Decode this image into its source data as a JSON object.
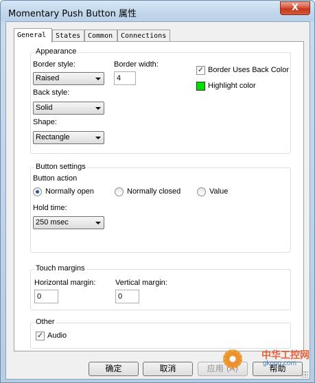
{
  "window": {
    "title": "Momentary Push Button 属性",
    "close_glyph": "X"
  },
  "tabs": [
    {
      "label": "General",
      "active": true
    },
    {
      "label": "States",
      "active": false
    },
    {
      "label": "Common",
      "active": false
    },
    {
      "label": "Connections",
      "active": false
    }
  ],
  "appearance": {
    "title": "Appearance",
    "border_style_label": "Border style:",
    "border_style_value": "Raised",
    "border_width_label": "Border width:",
    "border_width_value": "4",
    "back_style_label": "Back style:",
    "back_style_value": "Solid",
    "shape_label": "Shape:",
    "shape_value": "Rectangle",
    "border_uses_back_color_label": "Border Uses Back Color",
    "border_uses_back_color_checked": true,
    "highlight_color_label": "Highlight color",
    "highlight_color": "#00e000"
  },
  "button_settings": {
    "title": "Button settings",
    "action_label": "Button action",
    "options": [
      {
        "label": "Normally open",
        "selected": true
      },
      {
        "label": "Normally closed",
        "selected": false
      },
      {
        "label": "Value",
        "selected": false
      }
    ],
    "hold_time_label": "Hold time:",
    "hold_time_value": "250 msec"
  },
  "touch_margins": {
    "title": "Touch margins",
    "horizontal_label": "Horizontal margin:",
    "horizontal_value": "0",
    "vertical_label": "Vertical margin:",
    "vertical_value": "0"
  },
  "other": {
    "title": "Other",
    "audio_label": "Audio",
    "audio_checked": true
  },
  "buttons": {
    "ok": "确定",
    "cancel": "取消",
    "apply": "应用 (A)",
    "help": "帮助"
  },
  "watermark": {
    "text": "中华工控网",
    "sub": "gkong.com"
  }
}
